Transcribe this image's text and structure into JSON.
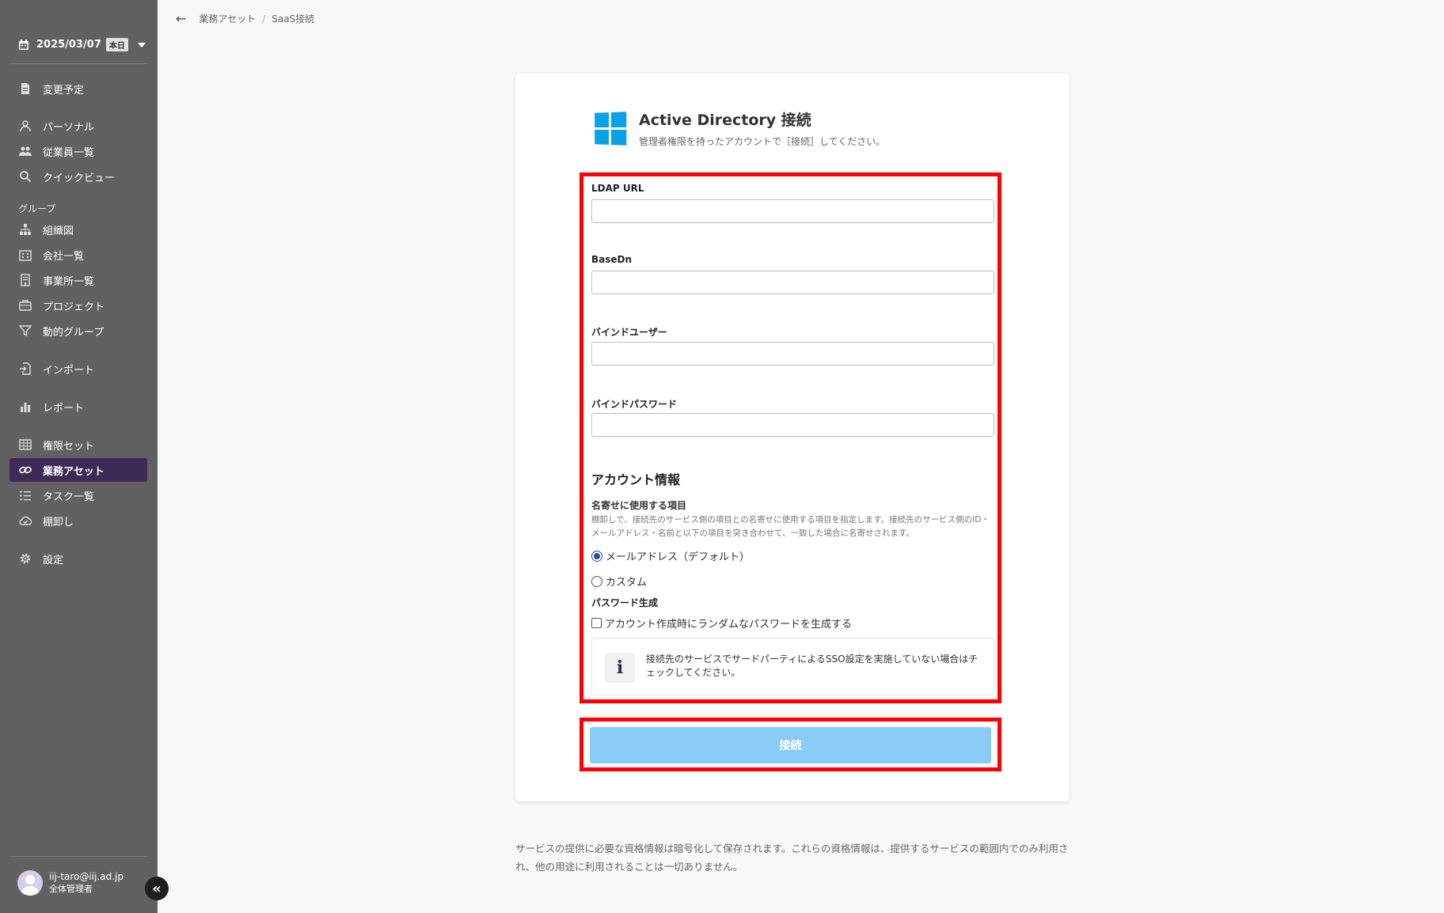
{
  "sidebar": {
    "date": "2025/03/07",
    "today_badge": "本日",
    "group_label": "グループ",
    "items": [
      {
        "label": "変更予定"
      },
      {
        "label": "パーソナル"
      },
      {
        "label": "従業員一覧"
      },
      {
        "label": "クイックビュー"
      },
      {
        "label": "組織図"
      },
      {
        "label": "会社一覧"
      },
      {
        "label": "事業所一覧"
      },
      {
        "label": "プロジェクト"
      },
      {
        "label": "動的グループ"
      },
      {
        "label": "インポート"
      },
      {
        "label": "レポート"
      },
      {
        "label": "権限セット"
      },
      {
        "label": "業務アセット"
      },
      {
        "label": "タスク一覧"
      },
      {
        "label": "棚卸し"
      },
      {
        "label": "設定"
      }
    ],
    "active_item": "業務アセット",
    "user": {
      "email": "iij-taro@iij.ad.jp",
      "role": "全体管理者"
    },
    "collapse_glyph": "«"
  },
  "breadcrumb": {
    "back_glyph": "←",
    "items": [
      "業務アセット",
      "SaaS接続"
    ],
    "separator": "/"
  },
  "card": {
    "title": "Active Directory 接続",
    "subtitle": "管理者権限を持ったアカウントで［接続］してください。",
    "fields": [
      {
        "label": "LDAP URL",
        "value": ""
      },
      {
        "label": "BaseDn",
        "value": ""
      },
      {
        "label": "バインドユーザー",
        "value": ""
      },
      {
        "label": "バインドパスワード",
        "value": ""
      }
    ],
    "account_section_title": "アカウント情報",
    "matching_title": "名寄せに使用する項目",
    "matching_desc": "棚卸しで、接続先のサービス側の項目との名寄せに使用する項目を指定します。接続先のサービス側のID・メールアドレス・名前と以下の項目を突き合わせて、一致した場合に名寄せされます。",
    "radio_options": [
      "メールアドレス（デフォルト）",
      "カスタム"
    ],
    "radio_selected": "メールアドレス（デフォルト）",
    "password_title": "パスワード生成",
    "password_checkbox_label": "アカウント作成時にランダムなパスワードを生成する",
    "password_checkbox_checked": false,
    "info_glyph": "i",
    "info_text": "接続先のサービスでサードパーティによるSSO設定を実施していない場合はチェックしてください。",
    "submit_label": "接続",
    "highlight_color": "#ff0000",
    "button_color": "#8acbf6"
  },
  "footer_note": "サービスの提供に必要な資格情報は暗号化して保存されます。これらの資格情報は、提供するサービスの範囲内でのみ利用され、他の用途に利用されることは一切ありません。"
}
